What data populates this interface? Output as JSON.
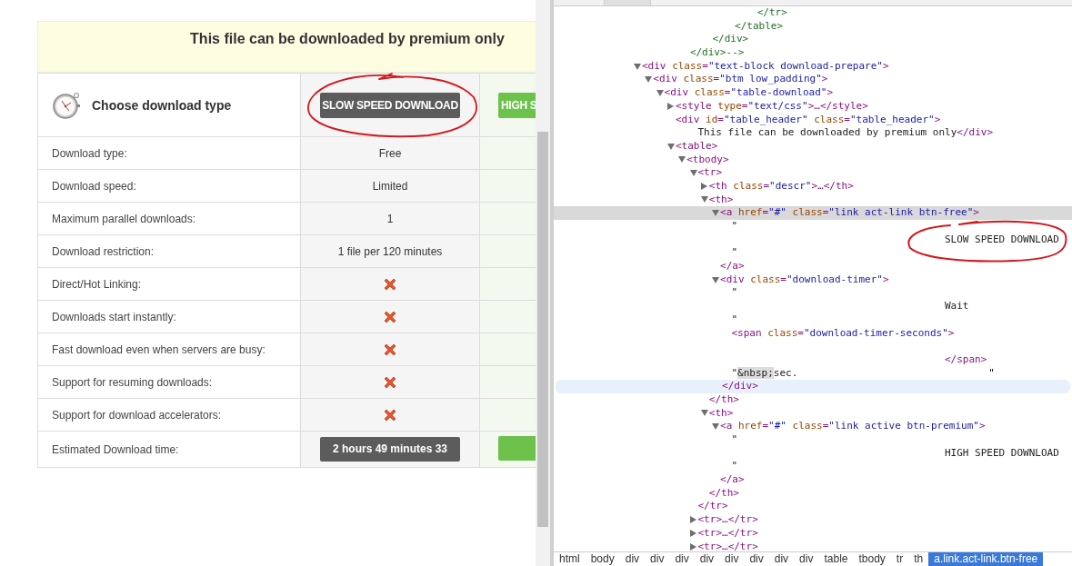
{
  "page": {
    "banner": "This file can be downloaded by premium only",
    "header": {
      "label": "Choose download type",
      "plans": [
        {
          "kind": "free",
          "button": "SLOW SPEED DOWNLOAD",
          "circled": true
        },
        {
          "kind": "premium",
          "button": "HIGH S",
          "circled": false
        }
      ]
    },
    "rows": [
      {
        "label": "Download type:",
        "cells": [
          {
            "kind": "text",
            "text": "Free"
          },
          {
            "kind": "blank"
          }
        ]
      },
      {
        "label": "Download speed:",
        "cells": [
          {
            "kind": "text",
            "text": "Limited"
          },
          {
            "kind": "blank"
          }
        ]
      },
      {
        "label": "Maximum parallel downloads:",
        "cells": [
          {
            "kind": "text",
            "text": "1"
          },
          {
            "kind": "blank"
          }
        ]
      },
      {
        "label": "Download restriction:",
        "cells": [
          {
            "kind": "text",
            "text": "1 file per 120 minutes"
          },
          {
            "kind": "blank"
          }
        ]
      },
      {
        "label": "Direct/Hot Linking:",
        "cells": [
          {
            "kind": "cross"
          },
          {
            "kind": "blank"
          }
        ]
      },
      {
        "label": "Downloads start instantly:",
        "cells": [
          {
            "kind": "cross"
          },
          {
            "kind": "blank"
          }
        ]
      },
      {
        "label": "Fast download even when servers are busy:",
        "cells": [
          {
            "kind": "cross"
          },
          {
            "kind": "blank"
          }
        ]
      },
      {
        "label": "Support for resuming downloads:",
        "cells": [
          {
            "kind": "cross"
          },
          {
            "kind": "blank"
          }
        ]
      },
      {
        "label": "Support for download accelerators:",
        "cells": [
          {
            "kind": "cross"
          },
          {
            "kind": "blank"
          }
        ]
      },
      {
        "label": "Estimated Download time:",
        "cells": [
          {
            "kind": "timer",
            "text": "2 hours 49 minutes 33"
          },
          {
            "kind": "bar"
          }
        ]
      }
    ]
  },
  "devtools": {
    "tree": [
      {
        "kind": "fragment",
        "close": "</div>-->",
        "children": [
          {
            "kind": "fragment",
            "close": "</div>",
            "children": [
              {
                "kind": "fragment",
                "close": "</table>",
                "children": [
                  {
                    "kind": "fragment",
                    "close": "</tr>"
                  }
                ]
              }
            ]
          }
        ]
      },
      {
        "kind": "element",
        "open": "<div class=\"text-block download-prepare\">",
        "expanded": true,
        "selected": false,
        "children": [
          {
            "kind": "element",
            "open": "<div class=\"btm low_padding\">",
            "expanded": true,
            "selected": false,
            "children": [
              {
                "kind": "element",
                "open": "<div class=\"table-download\">",
                "expanded": true,
                "selected": false,
                "children": [
                  {
                    "kind": "element",
                    "open": "<style type=\"text/css\">…</style>",
                    "expanded": false,
                    "selected": false
                  },
                  {
                    "kind": "inline_element",
                    "open": "<div id=\"table_header\" class=\"table_header\">",
                    "text": "This file can be downloaded by premium only",
                    "close": "</div>"
                  },
                  {
                    "kind": "element",
                    "open": "<table>",
                    "expanded": true,
                    "selected": false,
                    "children": [
                      {
                        "kind": "element",
                        "open": "<tbody>",
                        "expanded": true,
                        "selected": false,
                        "children": [
                          {
                            "kind": "element",
                            "open": "<tr>",
                            "expanded": true,
                            "selected": false,
                            "close": "</tr>",
                            "close_hovered": false,
                            "children": [
                              {
                                "kind": "element",
                                "open": "<th class=\"descr\">…</th>",
                                "expanded": false,
                                "selected": false
                              },
                              {
                                "kind": "element",
                                "open": "<th>",
                                "expanded": true,
                                "selected": false,
                                "close": "</th>",
                                "close_hovered": false,
                                "children": [
                                  {
                                    "kind": "element",
                                    "open": "<a href=\"#\" class=\"link act-link btn-free\">",
                                    "expanded": true,
                                    "selected": true,
                                    "close": "</a>",
                                    "close_hovered": false,
                                    "children": [
                                      {
                                        "kind": "text",
                                        "quote": "\"",
                                        "content": "SLOW SPEED DOWNLOAD",
                                        "circled": true,
                                        "end_quote": "\""
                                      }
                                    ]
                                  },
                                  {
                                    "kind": "element",
                                    "open": "<div class=\"download-timer\">",
                                    "expanded": true,
                                    "selected": false,
                                    "close": "</div>",
                                    "close_hovered": true,
                                    "children": [
                                      {
                                        "kind": "text",
                                        "quote": "\"",
                                        "content": "Wait",
                                        "circled": false,
                                        "end_quote": "\""
                                      },
                                      {
                                        "kind": "spaced_element",
                                        "open": "<span class=\"download-timer-seconds\">",
                                        "close": "</span>"
                                      },
                                      {
                                        "kind": "inline_text",
                                        "parts": [
                                          {
                                            "text": "\"",
                                            "marked": false
                                          },
                                          {
                                            "text": "&nbsp;",
                                            "marked": true
                                          },
                                          {
                                            "text": "sec.",
                                            "marked": false
                                          }
                                        ],
                                        "tail": "\""
                                      }
                                    ]
                                  }
                                ]
                              },
                              {
                                "kind": "element",
                                "open": "<th>",
                                "expanded": true,
                                "selected": false,
                                "close": "</th>",
                                "close_hovered": false,
                                "children": [
                                  {
                                    "kind": "element",
                                    "open": "<a href=\"#\" class=\"link active btn-premium\">",
                                    "expanded": true,
                                    "selected": false,
                                    "close": "</a>",
                                    "close_hovered": false,
                                    "children": [
                                      {
                                        "kind": "text",
                                        "quote": "\"",
                                        "content": "HIGH SPEED DOWNLOAD",
                                        "circled": false,
                                        "end_quote": "\""
                                      }
                                    ]
                                  }
                                ]
                              }
                            ]
                          },
                          {
                            "kind": "element",
                            "open": "<tr>…</tr>",
                            "expanded": false,
                            "selected": false
                          },
                          {
                            "kind": "element",
                            "open": "<tr>…</tr>",
                            "expanded": false,
                            "selected": false
                          },
                          {
                            "kind": "element",
                            "open": "<tr>…</tr>",
                            "expanded": false,
                            "selected": false
                          }
                        ]
                      }
                    ]
                  }
                ]
              }
            ]
          }
        ]
      }
    ],
    "breadcrumbs": [
      {
        "label": "html",
        "selected": false
      },
      {
        "label": "body",
        "selected": false
      },
      {
        "label": "div",
        "selected": false
      },
      {
        "label": "div",
        "selected": false
      },
      {
        "label": "div",
        "selected": false
      },
      {
        "label": "div",
        "selected": false
      },
      {
        "label": "div",
        "selected": false
      },
      {
        "label": "div",
        "selected": false
      },
      {
        "label": "div",
        "selected": false
      },
      {
        "label": "div",
        "selected": false
      },
      {
        "label": "table",
        "selected": false
      },
      {
        "label": "tbody",
        "selected": false
      },
      {
        "label": "tr",
        "selected": false
      },
      {
        "label": "th",
        "selected": false
      },
      {
        "label": "a.link.act-link.btn-free",
        "selected": true
      }
    ]
  }
}
